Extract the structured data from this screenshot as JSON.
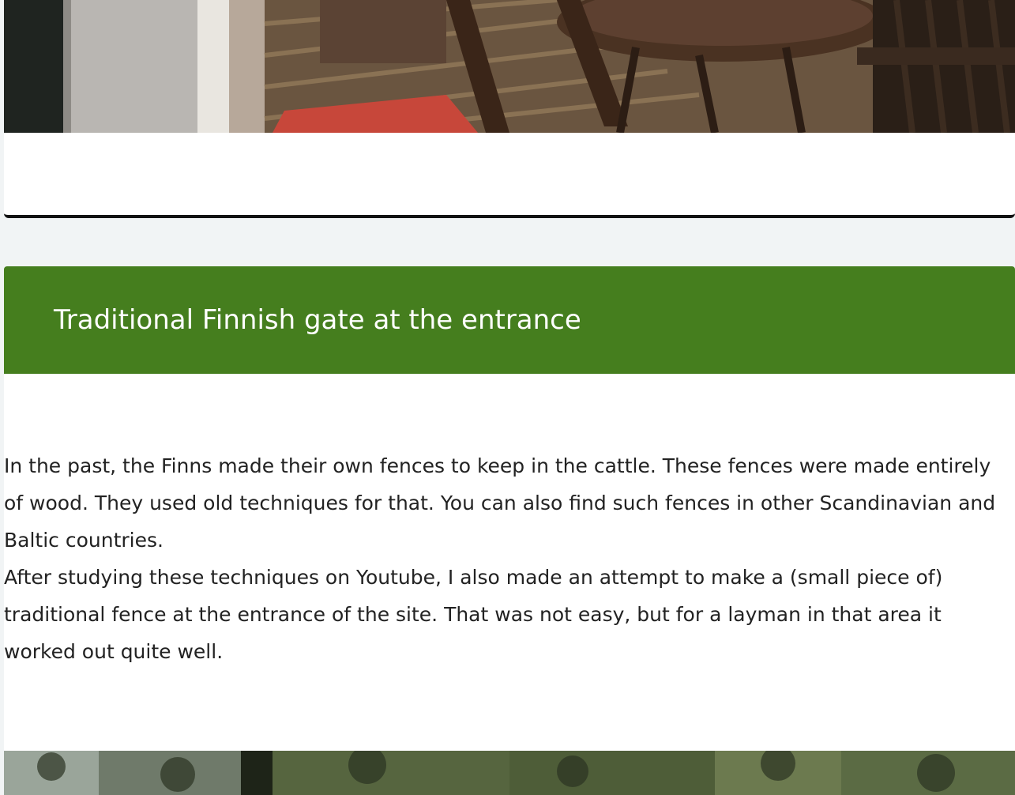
{
  "top_card": {
    "image_alt": "Wooden deck with table and chairs"
  },
  "section": {
    "title": "Traditional Finnish gate at the entrance",
    "paragraphs": [
      "In the past, the Finns made their own fences to keep in the cattle. These fences were made entirely of wood. They used old techniques for that. You can also find such fences in other Scandinavian and Baltic countries.",
      "After studying these techniques on Youtube, I also made an attempt to make a (small piece of) traditional fence at the entrance of the site. That was not easy, but for a layman in that area it worked out quite well."
    ]
  },
  "bottom_image": {
    "image_alt": "Forest at the entrance"
  },
  "colors": {
    "header_green": "#457e1e",
    "page_background": "#f1f4f5"
  }
}
